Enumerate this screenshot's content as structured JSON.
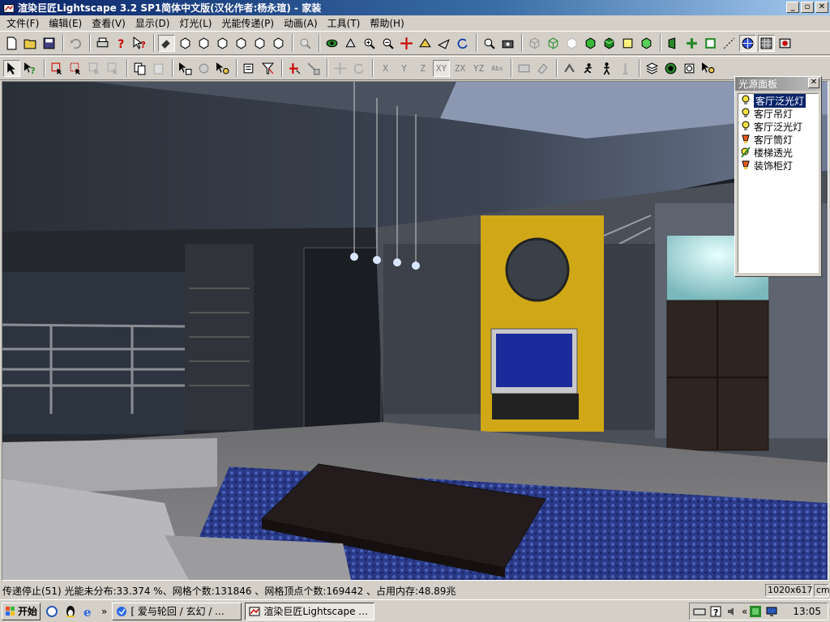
{
  "window": {
    "title": "渲染巨匠Lightscape 3.2 SP1简体中文版(汉化作者:杨永瑄) - 家装",
    "min_label": "_",
    "max_label": "▫",
    "close_label": "✕"
  },
  "menu": [
    {
      "label": "文件(F)"
    },
    {
      "label": "编辑(E)"
    },
    {
      "label": "查看(V)"
    },
    {
      "label": "显示(D)"
    },
    {
      "label": "灯光(L)"
    },
    {
      "label": "光能传递(P)"
    },
    {
      "label": "动画(A)"
    },
    {
      "label": "工具(T)"
    },
    {
      "label": "帮助(H)"
    }
  ],
  "toolbar2_axes": {
    "x": "X",
    "y": "Y",
    "z": "Z",
    "xy": "XY",
    "zx": "ZX",
    "yz": "YZ",
    "abs": "Abs"
  },
  "light_panel": {
    "title": "光源面板",
    "close_label": "✕",
    "items": [
      {
        "label": "客厅泛光灯",
        "icon": "bulb-icon",
        "selected": true
      },
      {
        "label": "客厅吊灯",
        "icon": "bulb-icon"
      },
      {
        "label": "客厅泛光灯",
        "icon": "bulb-icon"
      },
      {
        "label": "客厅筒灯",
        "icon": "spot-icon"
      },
      {
        "label": "楼梯透光",
        "icon": "linear-light-icon"
      },
      {
        "label": "装饰柜灯",
        "icon": "spot-icon"
      }
    ]
  },
  "status": {
    "text": "传递停止(51) 光能未分布:33.374 %、网格个数:131846 、网格顶点个数:169442 、占用内存:48.89兆",
    "resolution": "1020x617",
    "unit": "cm"
  },
  "taskbar": {
    "start_label": "开始",
    "more_label": "»",
    "tasks": [
      {
        "label": "[ 爱与轮回 / 玄幻 / ...",
        "active": false
      },
      {
        "label": "渲染巨匠Lightscape ...",
        "active": true
      }
    ],
    "clock": "13:05",
    "tray_more": "«"
  },
  "colors": {
    "title_bar": "#0a246a",
    "selection": "#0a246a",
    "wall_accent": "#d0a817",
    "tv_screen": "#1a2a9a"
  }
}
